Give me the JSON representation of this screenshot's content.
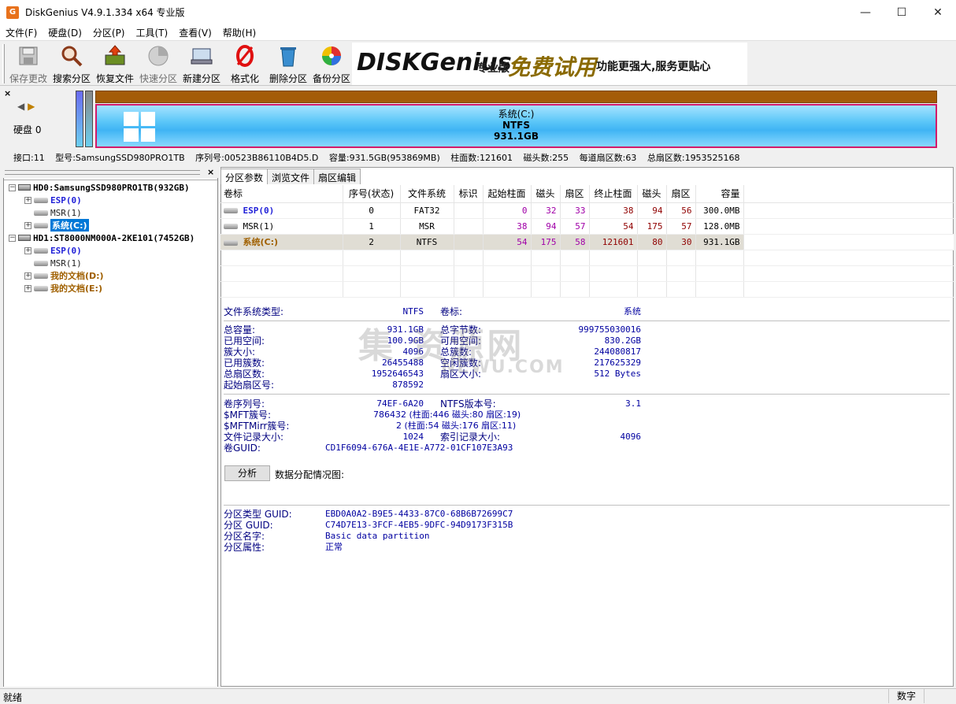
{
  "window": {
    "title": "DiskGenius V4.9.1.334 x64 专业版",
    "icon_letter": "G"
  },
  "menu": [
    "文件(F)",
    "硬盘(D)",
    "分区(P)",
    "工具(T)",
    "查看(V)",
    "帮助(H)"
  ],
  "toolbar": {
    "save": "保存更改",
    "search": "搜索分区",
    "recover": "恢复文件",
    "quick": "快速分区",
    "new": "新建分区",
    "format": "格式化",
    "delete": "删除分区",
    "backup": "备份分区"
  },
  "banner": {
    "brand": "DISKGenius",
    "edition": "专业版",
    "free": "免费试用",
    "slogan": "功能更强大,服务更贴心"
  },
  "diskmap": {
    "disk_label": "硬盘 0",
    "part_name": "系统(C:)",
    "part_fs": "NTFS",
    "part_size": "931.1GB"
  },
  "diskinfo": {
    "iface": "接口:11",
    "model": "型号:SamsungSSD980PRO1TB",
    "serial": "序列号:00523B86110B4D5.D",
    "capacity": "容量:931.5GB(953869MB)",
    "cylinders": "柱面数:121601",
    "heads": "磁头数:255",
    "sectors_per_track": "每道扇区数:63",
    "total_sectors": "总扇区数:1953525168"
  },
  "tree": {
    "hd0": "HD0:SamsungSSD980PRO1TB(932GB)",
    "hd0_esp": "ESP(0)",
    "hd0_msr": "MSR(1)",
    "hd0_sys": "系统(C:)",
    "hd1": "HD1:ST8000NM000A-2KE101(7452GB)",
    "hd1_esp": "ESP(0)",
    "hd1_msr": "MSR(1)",
    "hd1_d": "我的文档(D:)",
    "hd1_e": "我的文档(E:)"
  },
  "tabs": [
    "分区参数",
    "浏览文件",
    "扇区编辑"
  ],
  "table": {
    "headers": [
      "卷标",
      "序号(状态)",
      "文件系统",
      "标识",
      "起始柱面",
      "磁头",
      "扇区",
      "终止柱面",
      "磁头",
      "扇区",
      "容量"
    ],
    "rows": [
      [
        "ESP(0)",
        "0",
        "FAT32",
        "",
        "0",
        "32",
        "33",
        "38",
        "94",
        "56",
        "300.0MB"
      ],
      [
        "MSR(1)",
        "1",
        "MSR",
        "",
        "38",
        "94",
        "57",
        "54",
        "175",
        "57",
        "128.0MB"
      ],
      [
        "系统(C:)",
        "2",
        "NTFS",
        "",
        "54",
        "175",
        "58",
        "121601",
        "80",
        "30",
        "931.1GB"
      ]
    ]
  },
  "details": {
    "fs_type_label": "文件系统类型:",
    "fs_type": "NTFS",
    "vol_label_label": "卷标:",
    "vol_label": "系统",
    "total_cap_label": "总容量:",
    "total_cap": "931.1GB",
    "total_bytes_label": "总字节数:",
    "total_bytes": "999755030016",
    "used_label": "已用空间:",
    "used": "100.9GB",
    "free_label": "可用空间:",
    "free": "830.2GB",
    "cluster_size_label": "簇大小:",
    "cluster_size": "4096",
    "total_clusters_label": "总簇数:",
    "total_clusters": "244080817",
    "used_clusters_label": "已用簇数:",
    "used_clusters": "26455488",
    "free_clusters_label": "空闲簇数:",
    "free_clusters": "217625329",
    "total_sectors_label": "总扇区数:",
    "total_sectors": "1952646543",
    "sector_size_label": "扇区大小:",
    "sector_size": "512 Bytes",
    "start_sector_label": "起始扇区号:",
    "start_sector": "878592",
    "serial_label": "卷序列号:",
    "serial": "74EF-6A20",
    "ntfs_ver_label": "NTFS版本号:",
    "ntfs_ver": "3.1",
    "mft_label": "$MFT簇号:",
    "mft": "786432 (柱面:446 磁头:80 扇区:19)",
    "mftmirr_label": "$MFTMirr簇号:",
    "mftmirr": "2 (柱面:54 磁头:176 扇区:11)",
    "frs_label": "文件记录大小:",
    "frs": "1024",
    "irs_label": "索引记录大小:",
    "irs": "4096",
    "guid_label": "卷GUID:",
    "guid": "CD1F6094-676A-4E1E-A772-01CF107E3A93",
    "analyze_btn": "分析",
    "analyze_label": "数据分配情况图:",
    "ptype_guid_label": "分区类型 GUID:",
    "ptype_guid": "EBD0A0A2-B9E5-4433-87C0-68B6B72699C7",
    "pguid_label": "分区 GUID:",
    "pguid": "C74D7E13-3FCF-4EB5-9DFC-94D9173F315B",
    "pname_label": "分区名字:",
    "pname": "Basic data partition",
    "pattr_label": "分区属性:",
    "pattr": "正常"
  },
  "watermark": {
    "line1": "集   资源网",
    "line2": "NEWU.COM"
  },
  "status": {
    "left": "就绪",
    "right": "数字"
  }
}
